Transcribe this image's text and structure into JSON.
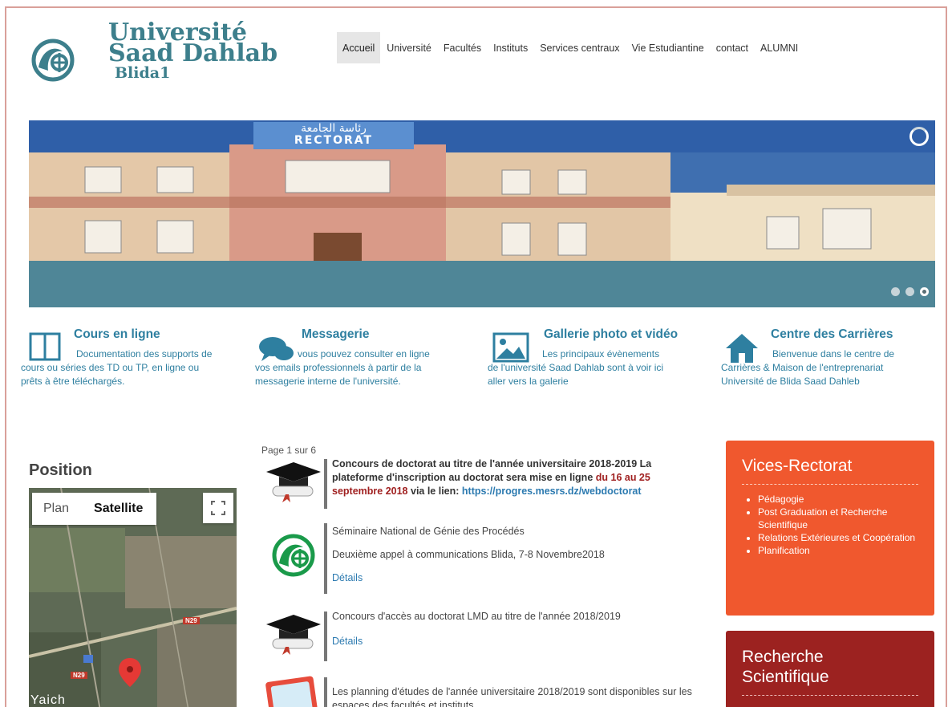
{
  "logo": {
    "line1": "Université",
    "line2": "Saad Dahlab",
    "line3": "Blida1"
  },
  "nav": [
    "Accueil",
    "Université",
    "Facultés",
    "Instituts",
    "Services centraux",
    "Vie Estudiantine",
    "contact",
    "ALUMNI"
  ],
  "slider": {
    "sign_arabic": "رئاسة الجامعة",
    "sign_latin": "RECTORAT"
  },
  "features": [
    {
      "title": "Cours en ligne",
      "line1": "Documentation des supports de",
      "line2": "cours ou séries des TD ou TP, en ligne ou",
      "line3": "prêts à être téléchargés."
    },
    {
      "title": "Messagerie",
      "line1": "vous pouvez consulter en ligne",
      "line2": "vos emails professionnels à partir de la",
      "line3": "messagerie interne de l'université."
    },
    {
      "title": "Gallerie photo et vidéo",
      "line1": "Les principaux évènements",
      "line2": "de l'université Saad Dahlab sont à voir ici",
      "line3": "aller vers la galerie"
    },
    {
      "title": "Centre des Carrières",
      "line1": "Bienvenue dans le centre de",
      "line2": "Carrières & Maison de l'entreprenariat",
      "line3": "Université de Blida Saad Dahleb"
    }
  ],
  "position": {
    "title": "Position",
    "map_tab_plan": "Plan",
    "map_tab_satellite": "Satellite",
    "road_label": "N29",
    "road_label2": "N29",
    "place_label": "Yaich"
  },
  "news": {
    "pager": "Page 1 sur 6",
    "items": [
      {
        "text_a": "Concours de doctorat au titre de l'année universitaire  2018-2019 La plateforme d'inscription au doctorat sera mise  en ligne ",
        "text_red": "du 16 au 25 septembre 2018",
        "text_b": "  via le lien: ",
        "link": "https://progres.mesrs.dz/webdoctorat"
      },
      {
        "line1": "Séminaire National de Génie des Procédés",
        "line2": "Deuxième appel à communications Blida, 7-8 Novembre2018",
        "details": "Détails"
      },
      {
        "line1": "Concours d'accès au doctorat LMD au titre de l'année 2018/2019",
        "details": "Détails"
      },
      {
        "line1": "Les planning d'études de l'année universitaire 2018/2019 sont disponibles sur les espaces des facultés et instituts."
      }
    ]
  },
  "sidebar": {
    "vice_title": "Vices-Rectorat",
    "vice_items": [
      "Pédagogie",
      "Post Graduation et Recherche Scientifique",
      "Relations Extérieures et Coopération",
      "Planification"
    ],
    "rech_title_1": "Recherche",
    "rech_title_2": "Scientifique"
  },
  "colors": {
    "accent": "#2e7fa0",
    "orange": "#f0582e",
    "darkred": "#9c2220",
    "slider_bg": "#4f8697"
  }
}
